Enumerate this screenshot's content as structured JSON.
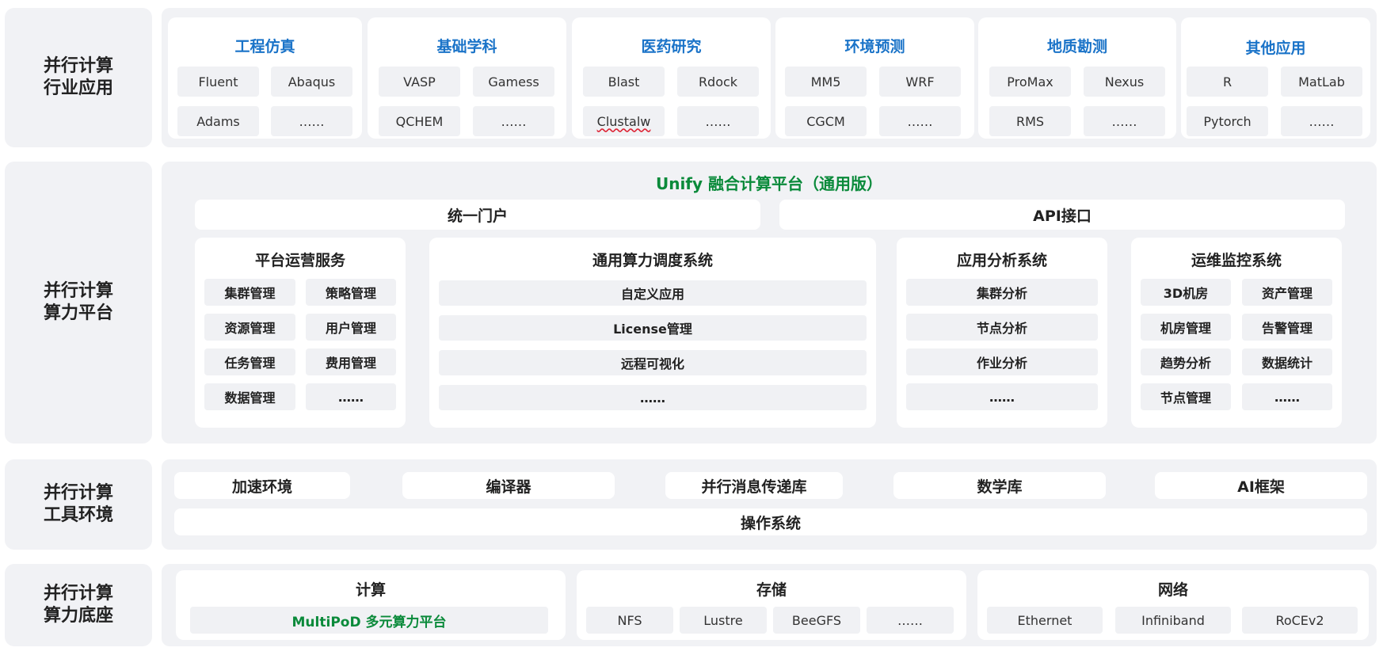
{
  "layers": {
    "l1": "并行计算\n行业应用",
    "l2": "并行计算\n算力平台",
    "l3": "并行计算\n工具环境",
    "l4": "并行计算\n算力底座"
  },
  "apps": [
    {
      "title": "工程仿真",
      "items": [
        "Fluent",
        "Abaqus",
        "Adams",
        "……"
      ]
    },
    {
      "title": "基础学科",
      "items": [
        "VASP",
        "Gamess",
        "QCHEM",
        "……"
      ]
    },
    {
      "title": "医药研究",
      "items": [
        "Blast",
        "Rdock",
        "Clustalw",
        "……"
      ]
    },
    {
      "title": "环境预测",
      "items": [
        "MM5",
        "WRF",
        "CGCM",
        "……"
      ]
    },
    {
      "title": "地质勘测",
      "items": [
        "ProMax",
        "Nexus",
        "RMS",
        "……"
      ]
    },
    {
      "title": "其他应用",
      "items": [
        "R",
        "MatLab",
        "Pytorch",
        "……"
      ]
    }
  ],
  "platform": {
    "title": "Unify 融合计算平台（通用版）",
    "portal": "统一门户",
    "api": "API接口",
    "ops": {
      "title": "平台运营服务",
      "items": [
        "集群管理",
        "策略管理",
        "资源管理",
        "用户管理",
        "任务管理",
        "费用管理",
        "数据管理",
        "……"
      ]
    },
    "sched": {
      "title": "通用算力调度系统",
      "items": [
        "自定义应用",
        "License管理",
        "远程可视化",
        "……"
      ]
    },
    "analysis": {
      "title": "应用分析系统",
      "items": [
        "集群分析",
        "节点分析",
        "作业分析",
        "……"
      ]
    },
    "monitor": {
      "title": "运维监控系统",
      "items": [
        "3D机房",
        "资产管理",
        "机房管理",
        "告警管理",
        "趋势分析",
        "数据统计",
        "节点管理",
        "……"
      ]
    }
  },
  "tools": {
    "items": [
      "加速环境",
      "编译器",
      "并行消息传递库",
      "数学库",
      "AI框架"
    ],
    "os": "操作系统"
  },
  "infra": {
    "compute": {
      "title": "计算",
      "platform": "MultiPoD 多元算力平台"
    },
    "storage": {
      "title": "存储",
      "items": [
        "NFS",
        "Lustre",
        "BeeGFS",
        "……"
      ]
    },
    "network": {
      "title": "网络",
      "items": [
        "Ethernet",
        "Infiniband",
        "RoCEv2"
      ]
    }
  }
}
